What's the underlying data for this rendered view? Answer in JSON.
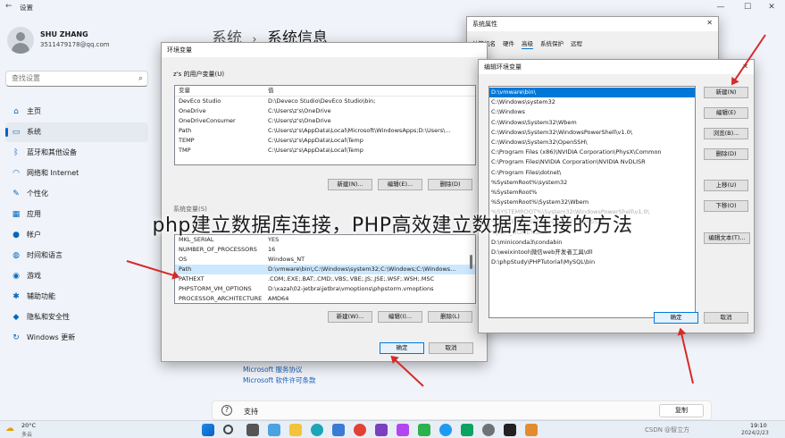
{
  "titlebar": {
    "title": "设置",
    "min": "—",
    "max": "☐",
    "close": "✕"
  },
  "user": {
    "name": "SHU ZHANG",
    "email": "3511479178@qq.com"
  },
  "search": {
    "placeholder": "查找设置"
  },
  "nav": [
    {
      "label": "主页",
      "icon": "home-icon",
      "glyph": "⌂"
    },
    {
      "label": "系统",
      "icon": "monitor-icon",
      "glyph": "▭"
    },
    {
      "label": "蓝牙和其他设备",
      "icon": "bluetooth-icon",
      "glyph": "ᛒ"
    },
    {
      "label": "网络和 Internet",
      "icon": "wifi-icon",
      "glyph": "◠"
    },
    {
      "label": "个性化",
      "icon": "brush-icon",
      "glyph": "✎"
    },
    {
      "label": "应用",
      "icon": "apps-icon",
      "glyph": "▦"
    },
    {
      "label": "帐户",
      "icon": "account-icon",
      "glyph": "●"
    },
    {
      "label": "时间和语言",
      "icon": "globe-icon",
      "glyph": "◍"
    },
    {
      "label": "游戏",
      "icon": "gamepad-icon",
      "glyph": "◉"
    },
    {
      "label": "辅助功能",
      "icon": "accessibility-icon",
      "glyph": "✱"
    },
    {
      "label": "隐私和安全性",
      "icon": "shield-icon",
      "glyph": "◆"
    },
    {
      "label": "Windows 更新",
      "icon": "update-icon",
      "glyph": "↻"
    }
  ],
  "breadcrumb": {
    "parent": "系统",
    "sep": "›",
    "current": "系统信息"
  },
  "links": {
    "service": "Microsoft 服务协议",
    "license": "Microsoft 软件许可条款"
  },
  "support": {
    "label": "支持",
    "copy": "复制"
  },
  "env": {
    "caption": "环境变量",
    "user_group": "z's 的用户变量(U)",
    "sys_group": "系统变量(S)",
    "col_var": "变量",
    "col_val": "值",
    "user_vars": [
      {
        "name": "DevEco Studio",
        "value": "D:\\Deveco Studio\\DevEco Studio\\bin;"
      },
      {
        "name": "OneDrive",
        "value": "C:\\Users\\z's\\OneDrive"
      },
      {
        "name": "OneDriveConsumer",
        "value": "C:\\Users\\z's\\OneDrive"
      },
      {
        "name": "Path",
        "value": "C:\\Users\\z's\\AppData\\Local\\Microsoft\\WindowsApps;D:\\Users\\..."
      },
      {
        "name": "TEMP",
        "value": "C:\\Users\\z's\\AppData\\Local\\Temp"
      },
      {
        "name": "TMP",
        "value": "C:\\Users\\z's\\AppData\\Local\\Temp"
      }
    ],
    "sys_vars": [
      {
        "name": "NUMBER_OF_PROCESSORS",
        "value": "16"
      },
      {
        "name": "OS",
        "value": "Windows_NT"
      },
      {
        "name": "Path",
        "value": "D:\\vmware\\bin\\;C:\\Windows\\system32;C:\\Windows;C:\\Windows..."
      },
      {
        "name": "PATHEXT",
        "value": ".COM;.EXE;.BAT;.CMD;.VBS;.VBE;.JS;.JSE;.WSF;.WSH;.MSC"
      },
      {
        "name": "PHPSTORM_VM_OPTIONS",
        "value": "D:\\xazal\\02-jetbra\\jetbra\\vmoptions\\phpstorm.vmoptions"
      }
    ],
    "sys_partial_top": {
      "name": "MKL_SERIAL",
      "value": "YES"
    },
    "sys_partial_bottom": {
      "name": "PROCESSOR_ARCHITECTURE",
      "value": "AMD64"
    },
    "btn_new_user": "新建(N)...",
    "btn_edit_user": "编辑(E)...",
    "btn_del_user": "删除(D)",
    "btn_new_sys": "新建(W)...",
    "btn_edit_sys": "编辑(I)...",
    "btn_del_sys": "删除(L)",
    "ok": "确定",
    "cancel": "取消"
  },
  "sysprops": {
    "caption": "系统属性",
    "tabs": [
      "计算机名",
      "硬件",
      "高级",
      "系统保护",
      "远程"
    ]
  },
  "edit": {
    "caption": "编辑环境变量",
    "entries": [
      "D:\\vmware\\bin\\",
      "C:\\Windows\\system32",
      "C:\\Windows",
      "C:\\Windows\\System32\\Wbem",
      "C:\\Windows\\System32\\WindowsPowerShell\\v1.0\\",
      "C:\\Windows\\System32\\OpenSSH\\",
      "C:\\Program Files (x86)\\NVIDIA Corporation\\PhysX\\Common",
      "C:\\Program Files\\NVIDIA Corporation\\NVIDIA NvDLISR",
      "C:\\Program Files\\dotnet\\",
      "%SystemRoot%\\system32",
      "%SystemRoot%",
      "%SystemRoot%\\System32\\Wbem",
      "%SYSTEMROOT%\\System32\\WindowsPowerShell\\v1.0\\",
      "%SYSTEMROOT%\\System32\\OpenSSH\\",
      "%JAVA_HOME%\\bin",
      "D:\\miniconda3\\condabin",
      "D:\\weixintool\\微信web开发者工具\\dll",
      "D:\\phpStudy\\PHPTutorial\\MySQL\\bin"
    ],
    "btn_new": "新建(N)",
    "btn_edit": "编辑(E)",
    "btn_browse": "浏览(B)...",
    "btn_delete": "删除(D)",
    "btn_up": "上移(U)",
    "btn_down": "下移(O)",
    "btn_edit_text": "编辑文本(T)...",
    "ok": "确定",
    "cancel": "取消",
    "close": "✕"
  },
  "overlay_title": "php建立数据库连接，PHP高效建立数据库连接的方法",
  "taskbar": {
    "temp": "20°C",
    "weather": "多云",
    "time": "19:10",
    "date": "2024/2/23",
    "watermark": "CSDN @智立方"
  }
}
